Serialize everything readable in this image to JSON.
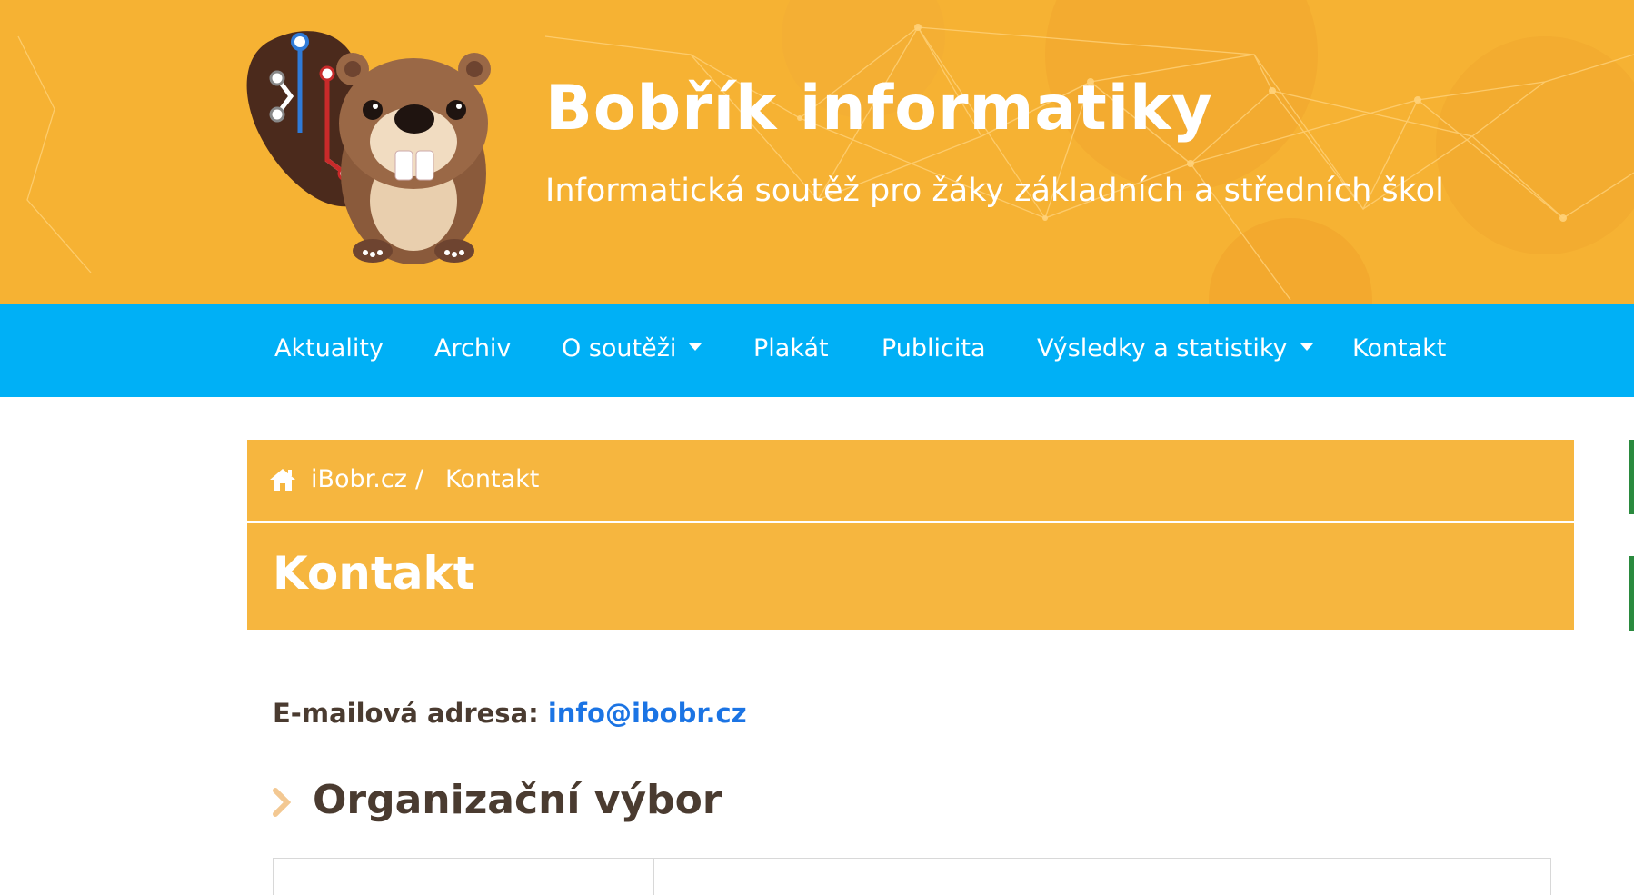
{
  "site": {
    "title": "Bobřík informatiky",
    "subtitle": "Informatická soutěž pro žáky základních a středních škol"
  },
  "nav": {
    "items": [
      {
        "label": "Aktuality",
        "dropdown": false
      },
      {
        "label": "Archiv",
        "dropdown": false
      },
      {
        "label": "O soutěži",
        "dropdown": true
      },
      {
        "label": "Plakát",
        "dropdown": false
      },
      {
        "label": "Publicita",
        "dropdown": false
      },
      {
        "label": "Výsledky a statistiky",
        "dropdown": true
      },
      {
        "label": "Kontakt",
        "dropdown": false
      }
    ]
  },
  "breadcrumb": {
    "home_label": "iBobr.cz",
    "separator": "/",
    "current": "Kontakt"
  },
  "page": {
    "title": "Kontakt",
    "email_label": "E-mailová adresa:",
    "email": "info@ibobr.cz",
    "section_title": "Organizační výbor"
  },
  "colors": {
    "header_bg": "#f6b233",
    "nav_bg": "#00b0f6",
    "title_box_bg": "#f6b63f",
    "link": "#1b74e4",
    "text_dark": "#4a3b30",
    "side_accent": "#2a8a3e"
  },
  "icons": {
    "home": "home-icon",
    "section_bullet": "chevron-right-icon",
    "dropdown": "caret-down-icon"
  }
}
